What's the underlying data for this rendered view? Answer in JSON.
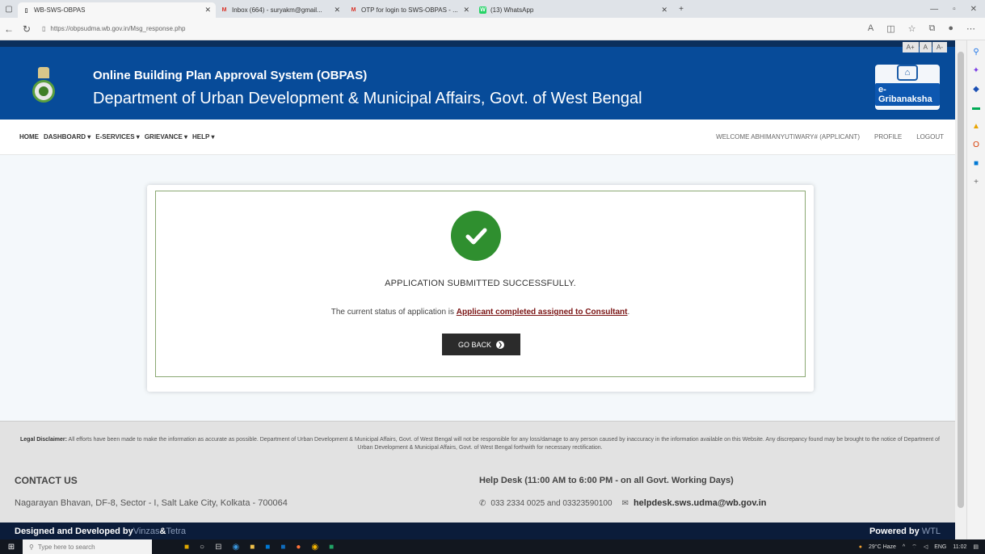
{
  "browser": {
    "tabs": [
      {
        "label": "WB-SWS-OBPAS",
        "icon": "page",
        "active": true
      },
      {
        "label": "Inbox (664) - suryakm@gmail...",
        "icon": "M",
        "active": false
      },
      {
        "label": "OTP for login to SWS-OBPAS - ...",
        "icon": "M",
        "active": false
      },
      {
        "label": "(13) WhatsApp",
        "icon": "W",
        "active": false
      }
    ],
    "url": "https://obpsudma.wb.gov.in/Msg_response.php"
  },
  "header": {
    "font_controls": [
      "A+",
      "A",
      "A-"
    ],
    "title": "Online Building Plan Approval System (OBPAS)",
    "subtitle": "Department of Urban Development & Municipal Affairs, Govt. of West Bengal",
    "logo_text": "e-Gribanaksha"
  },
  "nav": {
    "items": [
      "HOME",
      "DASHBOARD ▾",
      "E-SERVICES ▾",
      "GRIEVANCE ▾",
      "HELP ▾"
    ],
    "welcome": "WELCOME ABHIMANYUTIWARY# (APPLICANT)",
    "profile": "PROFILE",
    "logout": "LOGOUT"
  },
  "message": {
    "title": "APPLICATION SUBMITTED SUCCESSFULLY.",
    "status_prefix": "The current status of application is ",
    "status_value": "Applicant completed assigned to Consultant",
    "status_suffix": ".",
    "button": "GO BACK"
  },
  "footer": {
    "disclaimer_label": "Legal Disclaimer:",
    "disclaimer_text": " All efforts have been made to make the information as accurate as possible. Department of Urban Development & Municipal Affairs, Govt. of West Bengal will not be responsible for any loss/damage to any person caused by inaccuracy in the information available on this Website. Any discrepancy found may be brought to the notice of Department of Urban Development & Municipal Affairs, Govt. of West Bengal forthwith for necessary rectification.",
    "contact_heading": "CONTACT US",
    "address": "Nagarayan Bhavan, DF-8, Sector - I, Salt Lake City, Kolkata - 700064",
    "helpdesk_heading": "Help Desk (11:00 AM to 6:00 PM - on all Govt. Working Days)",
    "phones": "033 2334 0025 and 03323590100",
    "email": "helpdesk.sws.udma@wb.gov.in",
    "designed_by_prefix": "Designed and Developed by ",
    "designer1": "Vinzas",
    "designed_join": " & ",
    "designer2": "Tetra",
    "powered_by_prefix": "Powered by ",
    "powered_by": "WTL"
  },
  "taskbar": {
    "search_placeholder": "Type here to search",
    "weather": "29°C Haze",
    "lang": "ENG",
    "time": "11:02"
  },
  "colors": {
    "header_blue": "#074b99",
    "success_green": "#2f8f2f",
    "status_red": "#7a1414"
  }
}
